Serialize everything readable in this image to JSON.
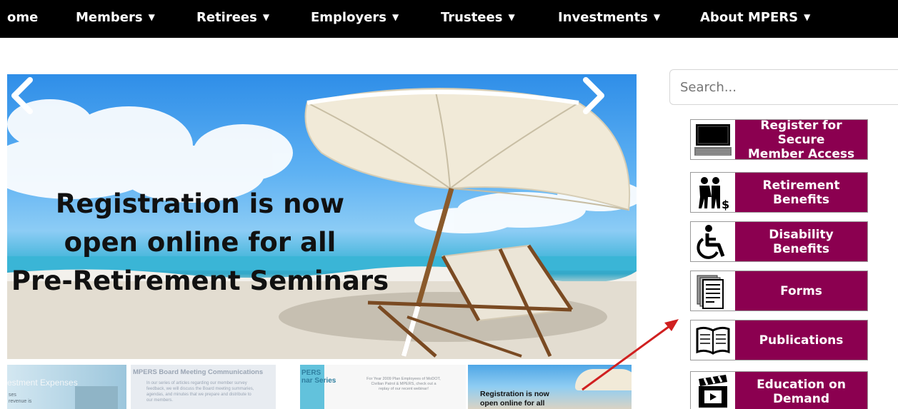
{
  "nav": {
    "items": [
      {
        "label": "ome",
        "caret": ""
      },
      {
        "label": "Members",
        "caret": "▼"
      },
      {
        "label": "Retirees",
        "caret": "▼"
      },
      {
        "label": "Employers",
        "caret": "▼"
      },
      {
        "label": "Trustees",
        "caret": "▼"
      },
      {
        "label": "Investments",
        "caret": "▼"
      },
      {
        "label": "About MPERS",
        "caret": "▼"
      }
    ]
  },
  "hero": {
    "lines": [
      "Registration is now",
      "open online for all",
      "Pre-Retirement Seminars"
    ],
    "prev_icon": "chevron-left-icon",
    "next_icon": "chevron-right-icon"
  },
  "thumbs": [
    {
      "title": "estment Expenses",
      "body": "ses\nrevenue is"
    },
    {
      "title": "MPERS Board Meeting Communications",
      "body": "In our series of articles regarding our member survey\nfeedback, we will discuss the Board meeting summaries,\nagendas, and minutes that we prepare and distribute to\nour members."
    },
    {
      "title": "PERS\nnar Series",
      "body": "For Year 2009 Plan Employees of MoDOT,\nCivilian Patrol & MPERS, check out a\nreplay of our recent webinar!"
    },
    {
      "title": "Registration is now\nopen online for all",
      "body": ""
    }
  ],
  "search": {
    "placeholder": "Search..."
  },
  "sidebar": {
    "buttons": [
      {
        "label": "Register for Secure\nMember Access",
        "icon": "laptop-icon"
      },
      {
        "label": "Retirement\nBenefits",
        "icon": "retirees-money-icon"
      },
      {
        "label": "Disability\nBenefits",
        "icon": "wheelchair-icon"
      },
      {
        "label": "Forms",
        "icon": "documents-icon"
      },
      {
        "label": "Publications",
        "icon": "open-book-icon"
      },
      {
        "label": "Education on\nDemand",
        "icon": "video-clapper-icon"
      }
    ]
  },
  "colors": {
    "brand": "#8b0050",
    "nav_bg": "#000000",
    "annotation_arrow": "#d02020"
  }
}
